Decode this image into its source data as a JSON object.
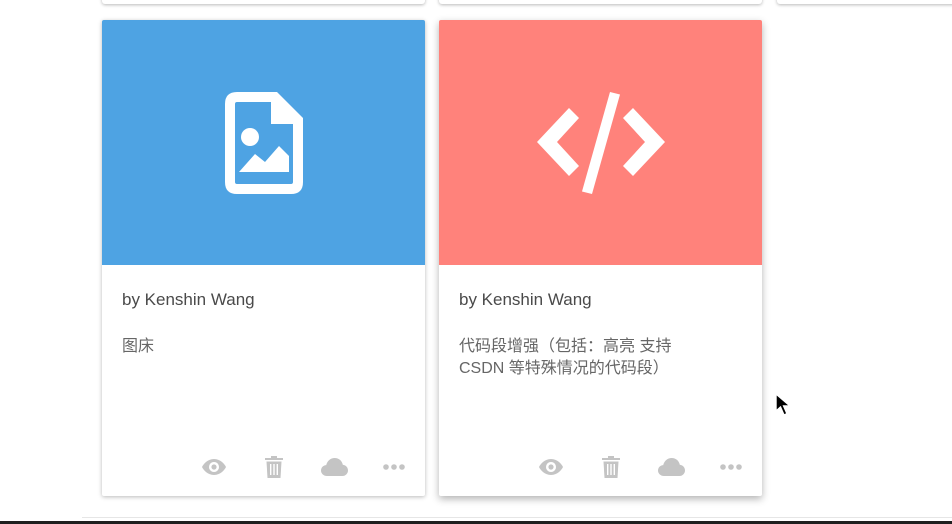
{
  "colors": {
    "image_banner": "#4ea3e3",
    "code_banner": "#ff827b",
    "action_icon": "#c4c4c4"
  },
  "cards": [
    {
      "icon": "image-file-icon",
      "author": "by Kenshin Wang",
      "description": "图床",
      "actions": [
        "eye-icon",
        "trash-icon",
        "cloud-icon",
        "more-icon"
      ]
    },
    {
      "icon": "code-icon",
      "author": "by Kenshin Wang",
      "description": "代码段增强（包括：高亮 支持 CSDN 等特殊情况的代码段）",
      "actions": [
        "eye-icon",
        "trash-icon",
        "cloud-icon",
        "more-icon"
      ]
    }
  ]
}
